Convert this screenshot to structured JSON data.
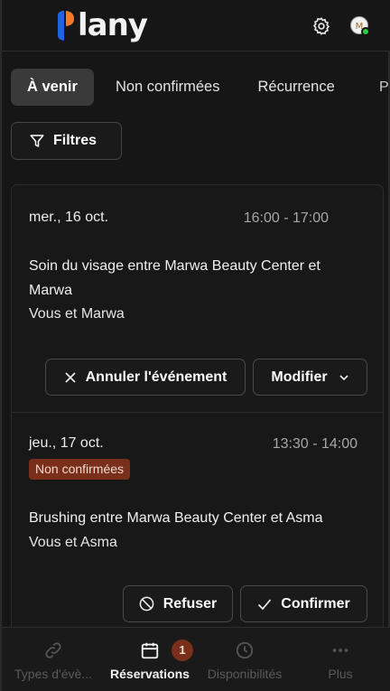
{
  "header": {
    "logo_text": "lany",
    "brand_colors": {
      "blue": "#1f63e6",
      "orange": "#f07b2a"
    },
    "settings_icon": "gear-icon",
    "avatar_icon": "user-avatar",
    "avatar_status_color": "#2ecc40"
  },
  "tabs": [
    {
      "label": "À venir",
      "active": true
    },
    {
      "label": "Non confirmées",
      "active": false
    },
    {
      "label": "Récurrence",
      "active": false
    },
    {
      "label": "P",
      "active": false
    }
  ],
  "filter": {
    "label": "Filtres",
    "icon": "filter-icon"
  },
  "bookings": [
    {
      "date": "mer., 16 oct.",
      "time": "16:00 - 17:00",
      "title": "Soin du visage entre Marwa Beauty Center et Marwa",
      "participants": "Vous et Marwa",
      "actions": {
        "cancel": "Annuler l'événement",
        "modify": "Modifier"
      }
    },
    {
      "date": "jeu., 17 oct.",
      "time": "13:30 - 14:00",
      "badge": "Non confirmées",
      "title": "Brushing entre Marwa Beauty Center et Asma",
      "participants": "Vous et Asma",
      "actions": {
        "refuse": "Refuser",
        "confirm": "Confirmer"
      }
    }
  ],
  "bottom_nav": [
    {
      "label": "Types d'évè...",
      "icon": "link-icon",
      "active": false
    },
    {
      "label": "Réservations",
      "icon": "calendar-icon",
      "active": true,
      "badge": "1"
    },
    {
      "label": "Disponibilités",
      "icon": "clock-icon",
      "active": false
    },
    {
      "label": "Plus",
      "icon": "more-dots-icon",
      "active": false
    }
  ]
}
